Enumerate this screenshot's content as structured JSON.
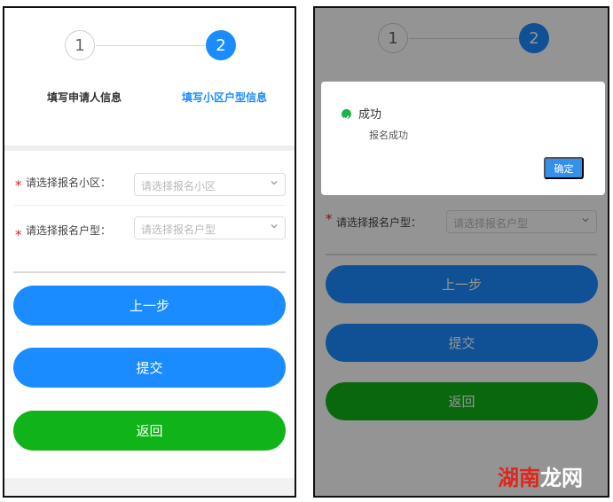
{
  "steps": [
    {
      "number": "1",
      "label": "填写申请人信息"
    },
    {
      "number": "2",
      "label": "填写小区户型信息"
    }
  ],
  "form": {
    "community": {
      "label": "请选择报名小区：",
      "placeholder": "请选择报名小区"
    },
    "house_type": {
      "label": "请选择报名户型：",
      "placeholder": "请选择报名户型"
    }
  },
  "buttons": {
    "prev": "上一步",
    "submit": "提交",
    "back": "返回"
  },
  "dialog": {
    "title": "成功",
    "message": "报名成功",
    "confirm": "确定"
  },
  "watermark": {
    "red_part": "湖南",
    "white_part": "龙网"
  },
  "colors": {
    "primary": "#1a8cff",
    "success_green": "#10b419",
    "required_red": "#e02020"
  },
  "icons": {
    "select_arrow": "chevron-down-icon",
    "dialog_status": "success-check-icon"
  }
}
